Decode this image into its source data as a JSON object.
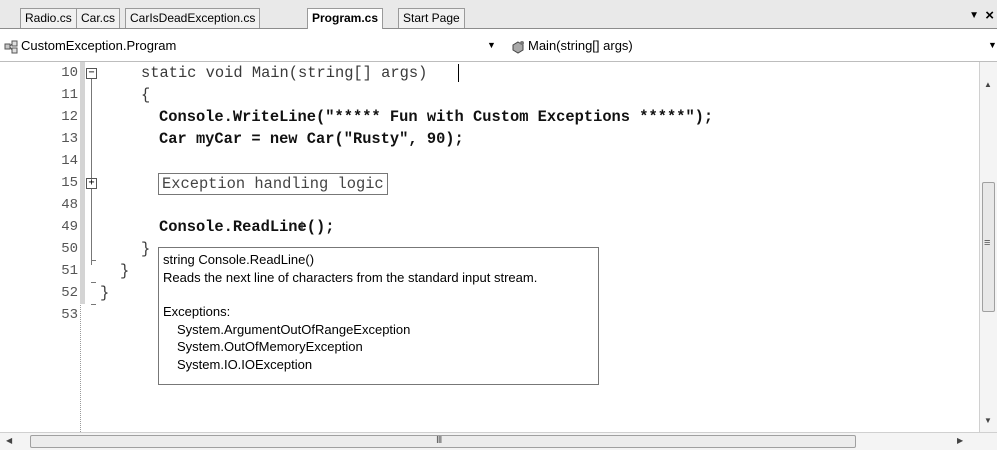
{
  "tabs": [
    {
      "label": "Radio.cs",
      "active": false
    },
    {
      "label": "Car.cs",
      "active": false
    },
    {
      "label": "CarIsDeadException.cs",
      "active": false
    },
    {
      "label": "Program.cs",
      "active": true
    },
    {
      "label": "Start Page",
      "active": false
    }
  ],
  "tab_menu_icon": "dropdown-arrow-icon",
  "tab_close_glyph": "×",
  "nav": {
    "type_combo": "CustomException.Program",
    "member_combo": "Main(string[] args)"
  },
  "code": {
    "lines": [
      {
        "no": "10",
        "text": "static void Main(string[] args)"
      },
      {
        "no": "11",
        "text": "{"
      },
      {
        "no": "12",
        "text": "Console.WriteLine(\"***** Fun with Custom Exceptions *****\");"
      },
      {
        "no": "13",
        "text": "Car myCar = new Car(\"Rusty\", 90);"
      },
      {
        "no": "14",
        "text": ""
      },
      {
        "no": "15",
        "text": "Exception handling logic"
      },
      {
        "no": "48",
        "text": ""
      },
      {
        "no": "49",
        "text": "Console.ReadLine();"
      },
      {
        "no": "50",
        "text": "}"
      },
      {
        "no": "51",
        "text": "}"
      },
      {
        "no": "52",
        "text": "}"
      },
      {
        "no": "53",
        "text": ""
      }
    ]
  },
  "tooltip": {
    "signature": "string Console.ReadLine()",
    "description": "Reads the next line of characters from the standard input stream.",
    "exceptions_header": "Exceptions:",
    "exceptions": [
      "System.ArgumentOutOfRangeException",
      "System.OutOfMemoryException",
      "System.IO.IOException"
    ]
  },
  "scroll_marks": {
    "v_mid": "≡",
    "h_mid": "III"
  }
}
